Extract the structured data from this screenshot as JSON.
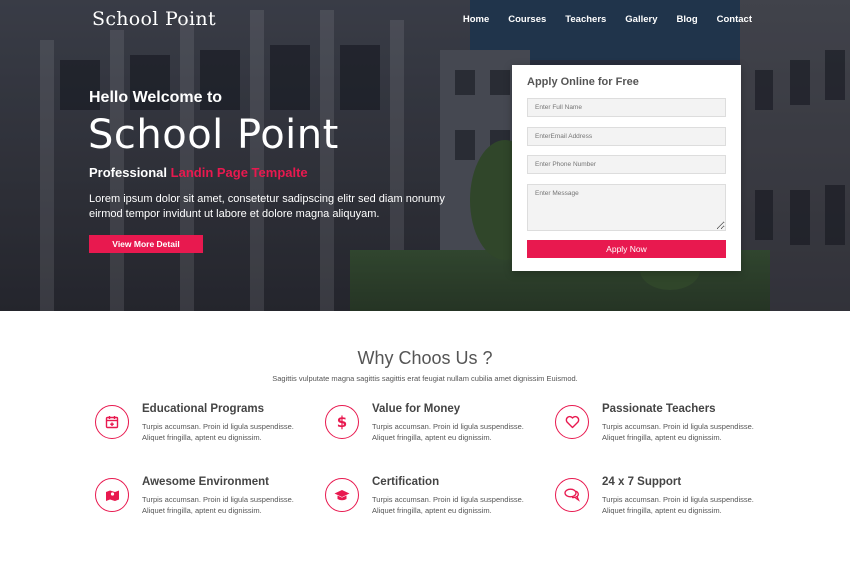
{
  "brand": {
    "logo": "School Point",
    "accent": "#e8194f"
  },
  "nav": {
    "items": [
      "Home",
      "Courses",
      "Teachers",
      "Gallery",
      "Blog",
      "Contact"
    ]
  },
  "hero": {
    "greeting": "Hello Welcome to",
    "title": "School Point",
    "subtitle_prefix": "Professional",
    "subtitle_accent": "Landin Page Tempalte",
    "lead": "Lorem ipsum dolor sit amet, consetetur sadipscing elitr sed diam nonumy eirmod tempor invidunt ut labore et dolore magna aliquyam.",
    "cta": "View More Detail"
  },
  "form": {
    "title": "Apply Online for Free",
    "full_name_placeholder": "Enter Full Name",
    "email_placeholder": "EnterEmail Address",
    "phone_placeholder": "Enter Phone Number",
    "message_placeholder": "Enter Message",
    "submit": "Apply Now"
  },
  "why": {
    "title": "Why Choos Us ?",
    "subtitle": "Sagittis vulputate magna sagittis sagittis erat feugiat nullam cubilia amet dignissim Euismod.",
    "features": [
      {
        "icon": "calendar-icon",
        "title": "Educational Programs",
        "text": "Turpis accumsan. Proin id ligula suspendisse. Aliquet fringilla, aptent eu dignissim."
      },
      {
        "icon": "dollar-icon",
        "title": "Value for Money",
        "text": "Turpis accumsan. Proin id ligula suspendisse. Aliquet fringilla, aptent eu dignissim."
      },
      {
        "icon": "heart-icon",
        "title": "Passionate Teachers",
        "text": "Turpis accumsan. Proin id ligula suspendisse. Aliquet fringilla, aptent eu dignissim."
      },
      {
        "icon": "map-icon",
        "title": "Awesome Environment",
        "text": "Turpis accumsan. Proin id ligula suspendisse. Aliquet fringilla, aptent eu dignissim."
      },
      {
        "icon": "graduation-cap-icon",
        "title": "Certification",
        "text": "Turpis accumsan. Proin id ligula suspendisse. Aliquet fringilla, aptent eu dignissim."
      },
      {
        "icon": "chat-icon",
        "title": "24 x 7 Support",
        "text": "Turpis accumsan. Proin id ligula suspendisse. Aliquet fringilla, aptent eu dignissim."
      }
    ]
  }
}
